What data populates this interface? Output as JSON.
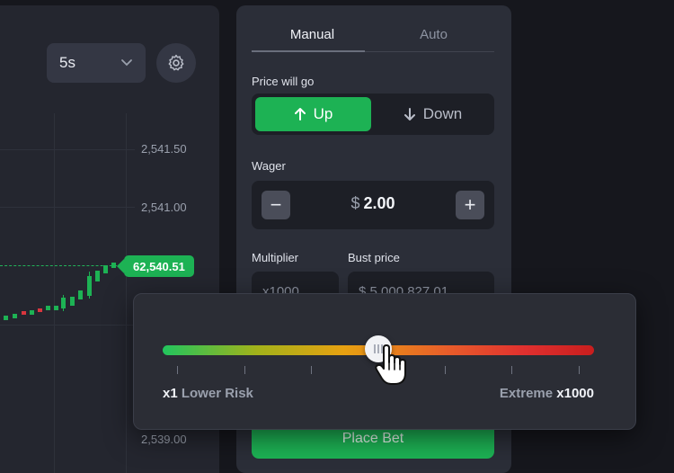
{
  "chart": {
    "timeframe": "5s",
    "price_ticks": [
      "2,541.50",
      "2,541.00",
      "2,539.00"
    ],
    "current_price": "62,540.51",
    "up_color": "#1db254",
    "down_color": "#d9363e"
  },
  "bet_panel": {
    "tabs": [
      {
        "label": "Manual",
        "active": true
      },
      {
        "label": "Auto",
        "active": false
      }
    ],
    "direction_label": "Price will go",
    "direction_up": "Up",
    "direction_down": "Down",
    "wager_label": "Wager",
    "wager_currency": "$",
    "wager_value": "2.00",
    "minus": "−",
    "plus": "+",
    "multiplier_label": "Multiplier",
    "multiplier_value": "x1000",
    "bust_label": "Bust price",
    "bust_value": "$ 5,000,827.01",
    "place_bet": "Place Bet"
  },
  "risk_slider": {
    "min_value": "x1",
    "min_label": "Lower Risk",
    "max_label": "Extreme",
    "max_value": "x1000",
    "position": 0.5
  },
  "icons": [
    "chevron-down-icon",
    "gear-icon",
    "arrow-up-icon",
    "arrow-down-icon",
    "hand-cursor-icon"
  ]
}
